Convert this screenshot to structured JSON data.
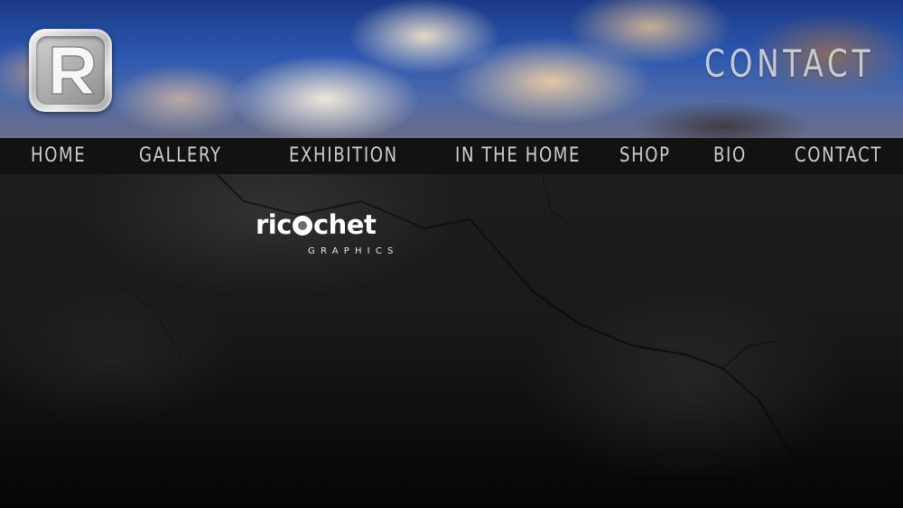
{
  "header": {
    "title": "CONTACT",
    "logo_icon": "ricochet-r-logo-icon"
  },
  "nav": {
    "items": [
      {
        "label": "HOME"
      },
      {
        "label": "GALLERY"
      },
      {
        "label": "EXHIBITION"
      },
      {
        "label": "IN THE HOME"
      },
      {
        "label": "SHOP"
      },
      {
        "label": "BIO"
      },
      {
        "label": "CONTACT"
      }
    ]
  },
  "brand": {
    "name_part1": "ric",
    "name_part2": "chet",
    "subtitle": "GRAPHICS"
  },
  "colors": {
    "nav_text": "#cfcfcf",
    "header_title": "#e6e6e6",
    "background": "#0b0b0b"
  }
}
